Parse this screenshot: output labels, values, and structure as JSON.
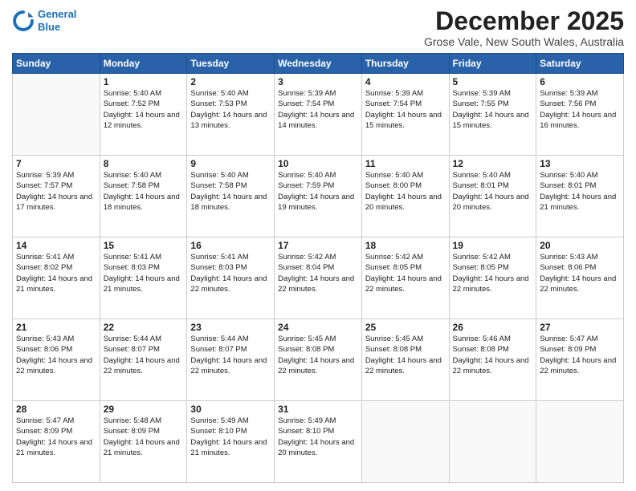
{
  "logo": {
    "line1": "General",
    "line2": "Blue"
  },
  "title": "December 2025",
  "location": "Grose Vale, New South Wales, Australia",
  "weekdays": [
    "Sunday",
    "Monday",
    "Tuesday",
    "Wednesday",
    "Thursday",
    "Friday",
    "Saturday"
  ],
  "weeks": [
    [
      {
        "day": "",
        "sunrise": "",
        "sunset": "",
        "daylight": ""
      },
      {
        "day": "1",
        "sunrise": "Sunrise: 5:40 AM",
        "sunset": "Sunset: 7:52 PM",
        "daylight": "Daylight: 14 hours and 12 minutes."
      },
      {
        "day": "2",
        "sunrise": "Sunrise: 5:40 AM",
        "sunset": "Sunset: 7:53 PM",
        "daylight": "Daylight: 14 hours and 13 minutes."
      },
      {
        "day": "3",
        "sunrise": "Sunrise: 5:39 AM",
        "sunset": "Sunset: 7:54 PM",
        "daylight": "Daylight: 14 hours and 14 minutes."
      },
      {
        "day": "4",
        "sunrise": "Sunrise: 5:39 AM",
        "sunset": "Sunset: 7:54 PM",
        "daylight": "Daylight: 14 hours and 15 minutes."
      },
      {
        "day": "5",
        "sunrise": "Sunrise: 5:39 AM",
        "sunset": "Sunset: 7:55 PM",
        "daylight": "Daylight: 14 hours and 15 minutes."
      },
      {
        "day": "6",
        "sunrise": "Sunrise: 5:39 AM",
        "sunset": "Sunset: 7:56 PM",
        "daylight": "Daylight: 14 hours and 16 minutes."
      }
    ],
    [
      {
        "day": "7",
        "sunrise": "Sunrise: 5:39 AM",
        "sunset": "Sunset: 7:57 PM",
        "daylight": "Daylight: 14 hours and 17 minutes."
      },
      {
        "day": "8",
        "sunrise": "Sunrise: 5:40 AM",
        "sunset": "Sunset: 7:58 PM",
        "daylight": "Daylight: 14 hours and 18 minutes."
      },
      {
        "day": "9",
        "sunrise": "Sunrise: 5:40 AM",
        "sunset": "Sunset: 7:58 PM",
        "daylight": "Daylight: 14 hours and 18 minutes."
      },
      {
        "day": "10",
        "sunrise": "Sunrise: 5:40 AM",
        "sunset": "Sunset: 7:59 PM",
        "daylight": "Daylight: 14 hours and 19 minutes."
      },
      {
        "day": "11",
        "sunrise": "Sunrise: 5:40 AM",
        "sunset": "Sunset: 8:00 PM",
        "daylight": "Daylight: 14 hours and 20 minutes."
      },
      {
        "day": "12",
        "sunrise": "Sunrise: 5:40 AM",
        "sunset": "Sunset: 8:01 PM",
        "daylight": "Daylight: 14 hours and 20 minutes."
      },
      {
        "day": "13",
        "sunrise": "Sunrise: 5:40 AM",
        "sunset": "Sunset: 8:01 PM",
        "daylight": "Daylight: 14 hours and 21 minutes."
      }
    ],
    [
      {
        "day": "14",
        "sunrise": "Sunrise: 5:41 AM",
        "sunset": "Sunset: 8:02 PM",
        "daylight": "Daylight: 14 hours and 21 minutes."
      },
      {
        "day": "15",
        "sunrise": "Sunrise: 5:41 AM",
        "sunset": "Sunset: 8:03 PM",
        "daylight": "Daylight: 14 hours and 21 minutes."
      },
      {
        "day": "16",
        "sunrise": "Sunrise: 5:41 AM",
        "sunset": "Sunset: 8:03 PM",
        "daylight": "Daylight: 14 hours and 22 minutes."
      },
      {
        "day": "17",
        "sunrise": "Sunrise: 5:42 AM",
        "sunset": "Sunset: 8:04 PM",
        "daylight": "Daylight: 14 hours and 22 minutes."
      },
      {
        "day": "18",
        "sunrise": "Sunrise: 5:42 AM",
        "sunset": "Sunset: 8:05 PM",
        "daylight": "Daylight: 14 hours and 22 minutes."
      },
      {
        "day": "19",
        "sunrise": "Sunrise: 5:42 AM",
        "sunset": "Sunset: 8:05 PM",
        "daylight": "Daylight: 14 hours and 22 minutes."
      },
      {
        "day": "20",
        "sunrise": "Sunrise: 5:43 AM",
        "sunset": "Sunset: 8:06 PM",
        "daylight": "Daylight: 14 hours and 22 minutes."
      }
    ],
    [
      {
        "day": "21",
        "sunrise": "Sunrise: 5:43 AM",
        "sunset": "Sunset: 8:06 PM",
        "daylight": "Daylight: 14 hours and 22 minutes."
      },
      {
        "day": "22",
        "sunrise": "Sunrise: 5:44 AM",
        "sunset": "Sunset: 8:07 PM",
        "daylight": "Daylight: 14 hours and 22 minutes."
      },
      {
        "day": "23",
        "sunrise": "Sunrise: 5:44 AM",
        "sunset": "Sunset: 8:07 PM",
        "daylight": "Daylight: 14 hours and 22 minutes."
      },
      {
        "day": "24",
        "sunrise": "Sunrise: 5:45 AM",
        "sunset": "Sunset: 8:08 PM",
        "daylight": "Daylight: 14 hours and 22 minutes."
      },
      {
        "day": "25",
        "sunrise": "Sunrise: 5:45 AM",
        "sunset": "Sunset: 8:08 PM",
        "daylight": "Daylight: 14 hours and 22 minutes."
      },
      {
        "day": "26",
        "sunrise": "Sunrise: 5:46 AM",
        "sunset": "Sunset: 8:08 PM",
        "daylight": "Daylight: 14 hours and 22 minutes."
      },
      {
        "day": "27",
        "sunrise": "Sunrise: 5:47 AM",
        "sunset": "Sunset: 8:09 PM",
        "daylight": "Daylight: 14 hours and 22 minutes."
      }
    ],
    [
      {
        "day": "28",
        "sunrise": "Sunrise: 5:47 AM",
        "sunset": "Sunset: 8:09 PM",
        "daylight": "Daylight: 14 hours and 21 minutes."
      },
      {
        "day": "29",
        "sunrise": "Sunrise: 5:48 AM",
        "sunset": "Sunset: 8:09 PM",
        "daylight": "Daylight: 14 hours and 21 minutes."
      },
      {
        "day": "30",
        "sunrise": "Sunrise: 5:49 AM",
        "sunset": "Sunset: 8:10 PM",
        "daylight": "Daylight: 14 hours and 21 minutes."
      },
      {
        "day": "31",
        "sunrise": "Sunrise: 5:49 AM",
        "sunset": "Sunset: 8:10 PM",
        "daylight": "Daylight: 14 hours and 20 minutes."
      },
      {
        "day": "",
        "sunrise": "",
        "sunset": "",
        "daylight": ""
      },
      {
        "day": "",
        "sunrise": "",
        "sunset": "",
        "daylight": ""
      },
      {
        "day": "",
        "sunrise": "",
        "sunset": "",
        "daylight": ""
      }
    ]
  ]
}
